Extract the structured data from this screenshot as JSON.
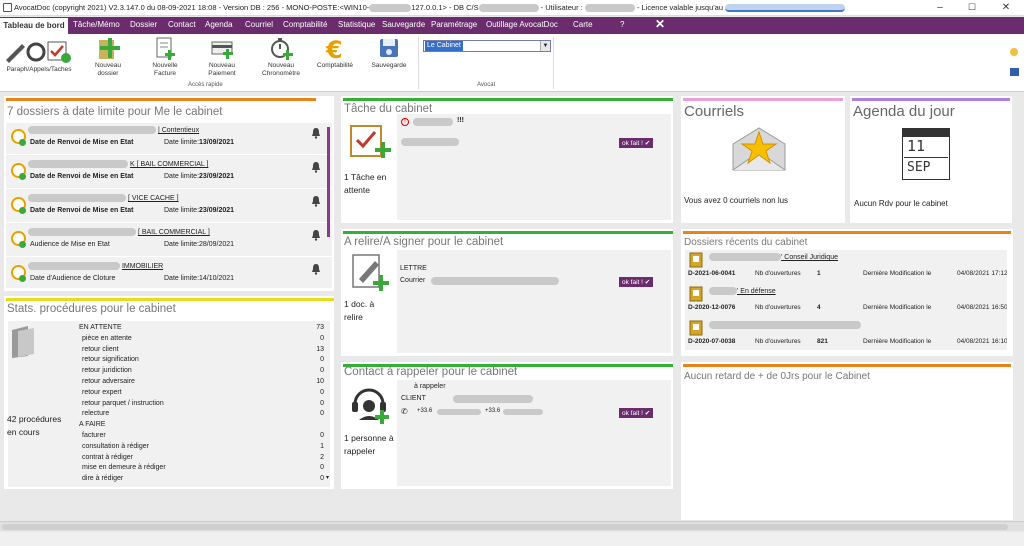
{
  "window": {
    "title": "AvocatDoc (copyright 2021) V2.3.147.0 du 08-09-2021 18:08 - Version DB : 256 - MONO-POSTE:<WIN10-",
    "title_mid": "127.0.0.1> - DB C/S",
    "title_user": " - Utilisateur :",
    "title_lic": "- Licence valable jusqu'au",
    "min": "–",
    "max": "☐",
    "close": "✕"
  },
  "menu": {
    "active": "Tableau de bord",
    "items": [
      "Tâche/Mémo",
      "Dossier",
      "Contact",
      "Agenda",
      "Courriel",
      "Comptabilité",
      "Statistique",
      "Sauvegarde",
      "Paramétrage",
      "Outillage AvocatDoc",
      "Carte",
      "?"
    ],
    "close": "✕"
  },
  "toolbar": {
    "paraph": "Paraph/Appels/Taches",
    "nouveau_dossier": [
      "Nouveau",
      "dossier"
    ],
    "nouvelle_facture": [
      "Nouvelle",
      "Facture"
    ],
    "nouveau_paiement": [
      "Nouveau",
      "Paiement"
    ],
    "nouveau_chrono": [
      "Nouveau",
      "Chronomètre"
    ],
    "comptabilite": "Comptabilité",
    "sauvegarde": "Sauvegarde",
    "group_rapide": "Accès rapide",
    "group_avocat": "Avocat",
    "avocat_select": "Le Cabinet"
  },
  "dossiers": {
    "title": "7 dossiers à date limite pour Me le cabinet",
    "rows": [
      {
        "type": "| Contentieux",
        "label": "Date de Renvoi de Mise en Etat",
        "prefix": "Date limite:",
        "date": "13/09/2021",
        "bold": true
      },
      {
        "type": "K [ BAIL COMMERCIAL ]",
        "label": "Date de Renvoi de Mise en Etat",
        "prefix": "Date limite:",
        "date": "23/09/2021",
        "bold": true
      },
      {
        "type": "[ VICE CACHE ]",
        "label": "Date de Renvoi de Mise en Etat",
        "prefix": "Date limite:",
        "date": "23/09/2021",
        "bold": true
      },
      {
        "type": "[ BAIL COMMERCIAL ]",
        "label": "Audience de Mise en Etat",
        "prefix": "Date limite:",
        "date": "28/09/2021",
        "bold": false
      },
      {
        "type": "IMMOBILIER",
        "label": "Date d'Audience de Cloture",
        "prefix": "Date limite:",
        "date": "14/10/2021",
        "bold": false
      }
    ]
  },
  "stats": {
    "title": "Stats. procédures pour le cabinet",
    "summary": [
      "42 procédures",
      "en cours"
    ],
    "rows": [
      {
        "label": "EN ATTENTE",
        "v": "73",
        "head": true
      },
      {
        "label": "pièce en attente",
        "v": "0"
      },
      {
        "label": "retour client",
        "v": "13"
      },
      {
        "label": "retour signification",
        "v": "0"
      },
      {
        "label": "retour juridiction",
        "v": "0"
      },
      {
        "label": "retour adversaire",
        "v": "10"
      },
      {
        "label": "retour expert",
        "v": "0"
      },
      {
        "label": "retour parquet / instruction",
        "v": "0"
      },
      {
        "label": "relecture",
        "v": "0"
      },
      {
        "label": "A FAIRE",
        "v": "",
        "head": true
      },
      {
        "label": "facturer",
        "v": "0"
      },
      {
        "label": "consultation à rédiger",
        "v": "1"
      },
      {
        "label": "contrat à rédiger",
        "v": "2"
      },
      {
        "label": "mise en demeure à rédiger",
        "v": "0"
      },
      {
        "label": "dire à rédiger",
        "v": "0"
      }
    ]
  },
  "tache": {
    "title": "Tâche du cabinet",
    "count": [
      "1 Tâche en",
      "attente"
    ],
    "excl": "!!!",
    "ok": "ok fait ! ✔"
  },
  "relire": {
    "title": "A relire/A signer pour le cabinet",
    "count": [
      "1 doc. à",
      "relire"
    ],
    "doc_type": "LETTRE",
    "doc_kind": "Courrier",
    "ok": "ok fait ! ✔"
  },
  "contact": {
    "title": "Contact à rappeler pour le cabinet",
    "count": [
      "1 personne à",
      "rappeler"
    ],
    "action": "à rappeler",
    "kind": "CLIENT",
    "phone1": "+33.6",
    "phone2": "+33.6",
    "ok": "ok fait ! ✔"
  },
  "courriels": {
    "title": "Courriels",
    "text": "Vous avez 0 courriels non lus"
  },
  "agenda": {
    "title": "Agenda du jour",
    "day": "11",
    "month": "SEP",
    "text": "Aucun Rdv pour le cabinet"
  },
  "recents": {
    "title": "Dossiers récents du cabinet",
    "rows": [
      {
        "name": "' Conseil Juridique",
        "ref": "D-2021-06-0041",
        "nb_label": "Nb d'ouvertures",
        "nb": "1",
        "mod_label": "Dernière Modification le",
        "mod": "04/08/2021 17:12"
      },
      {
        "name": "' En défense",
        "ref": "D-2020-12-0076",
        "nb_label": "Nb d'ouvertures",
        "nb": "4",
        "mod_label": "Dernière Modification le",
        "mod": "04/08/2021 16:50"
      },
      {
        "name": "",
        "ref": "D-2020-07-0038",
        "nb_label": "Nb d'ouvertures",
        "nb": "821",
        "mod_label": "Dernière Modification le",
        "mod": "04/08/2021 16:10"
      }
    ]
  },
  "retard": {
    "title": "Aucun retard de + de 0Jrs pour le Cabinet"
  },
  "colors": {
    "menu": "#6b2c6e",
    "orange": "#e8841a",
    "green": "#33b035",
    "yellow": "#e6dd1a",
    "pink": "#e9a0dc",
    "purple": "#b081d6"
  }
}
